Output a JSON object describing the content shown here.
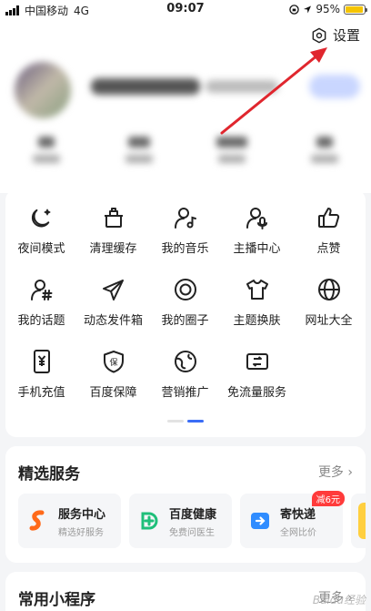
{
  "status_bar": {
    "carrier": "中国移动",
    "network": "4G",
    "time": "09:07",
    "battery": "95%",
    "battery_level": 0.95
  },
  "header": {
    "settings_label": "设置",
    "username_blurred": true
  },
  "grid_items": [
    {
      "label": "夜间模式",
      "icon": "moon-icon"
    },
    {
      "label": "清理缓存",
      "icon": "clean-icon"
    },
    {
      "label": "我的音乐",
      "icon": "music-icon"
    },
    {
      "label": "主播中心",
      "icon": "anchor-icon"
    },
    {
      "label": "点赞",
      "icon": "thumb-up-icon"
    },
    {
      "label": "我的话题",
      "icon": "topic-icon"
    },
    {
      "label": "动态发件箱",
      "icon": "send-icon"
    },
    {
      "label": "我的圈子",
      "icon": "circle-icon"
    },
    {
      "label": "主题换肤",
      "icon": "shirt-icon"
    },
    {
      "label": "网址大全",
      "icon": "globe-icon"
    },
    {
      "label": "手机充值",
      "icon": "phone-recharge-icon"
    },
    {
      "label": "百度保障",
      "icon": "shield-icon"
    },
    {
      "label": "营销推广",
      "icon": "promote-icon"
    },
    {
      "label": "免流量服务",
      "icon": "data-free-icon"
    }
  ],
  "featured": {
    "title": "精选服务",
    "more": "更多",
    "items": [
      {
        "name": "服务中心",
        "sub": "精选好服务",
        "color": "#ff6a1a"
      },
      {
        "name": "百度健康",
        "sub": "免费问医生",
        "color": "#1fbf7a"
      },
      {
        "name": "寄快递",
        "sub": "全网比价",
        "badge": "减6元",
        "color": "#2f8cff"
      }
    ]
  },
  "mini_programs": {
    "title": "常用小程序",
    "more": "更多"
  },
  "watermark": "Baidu经验"
}
